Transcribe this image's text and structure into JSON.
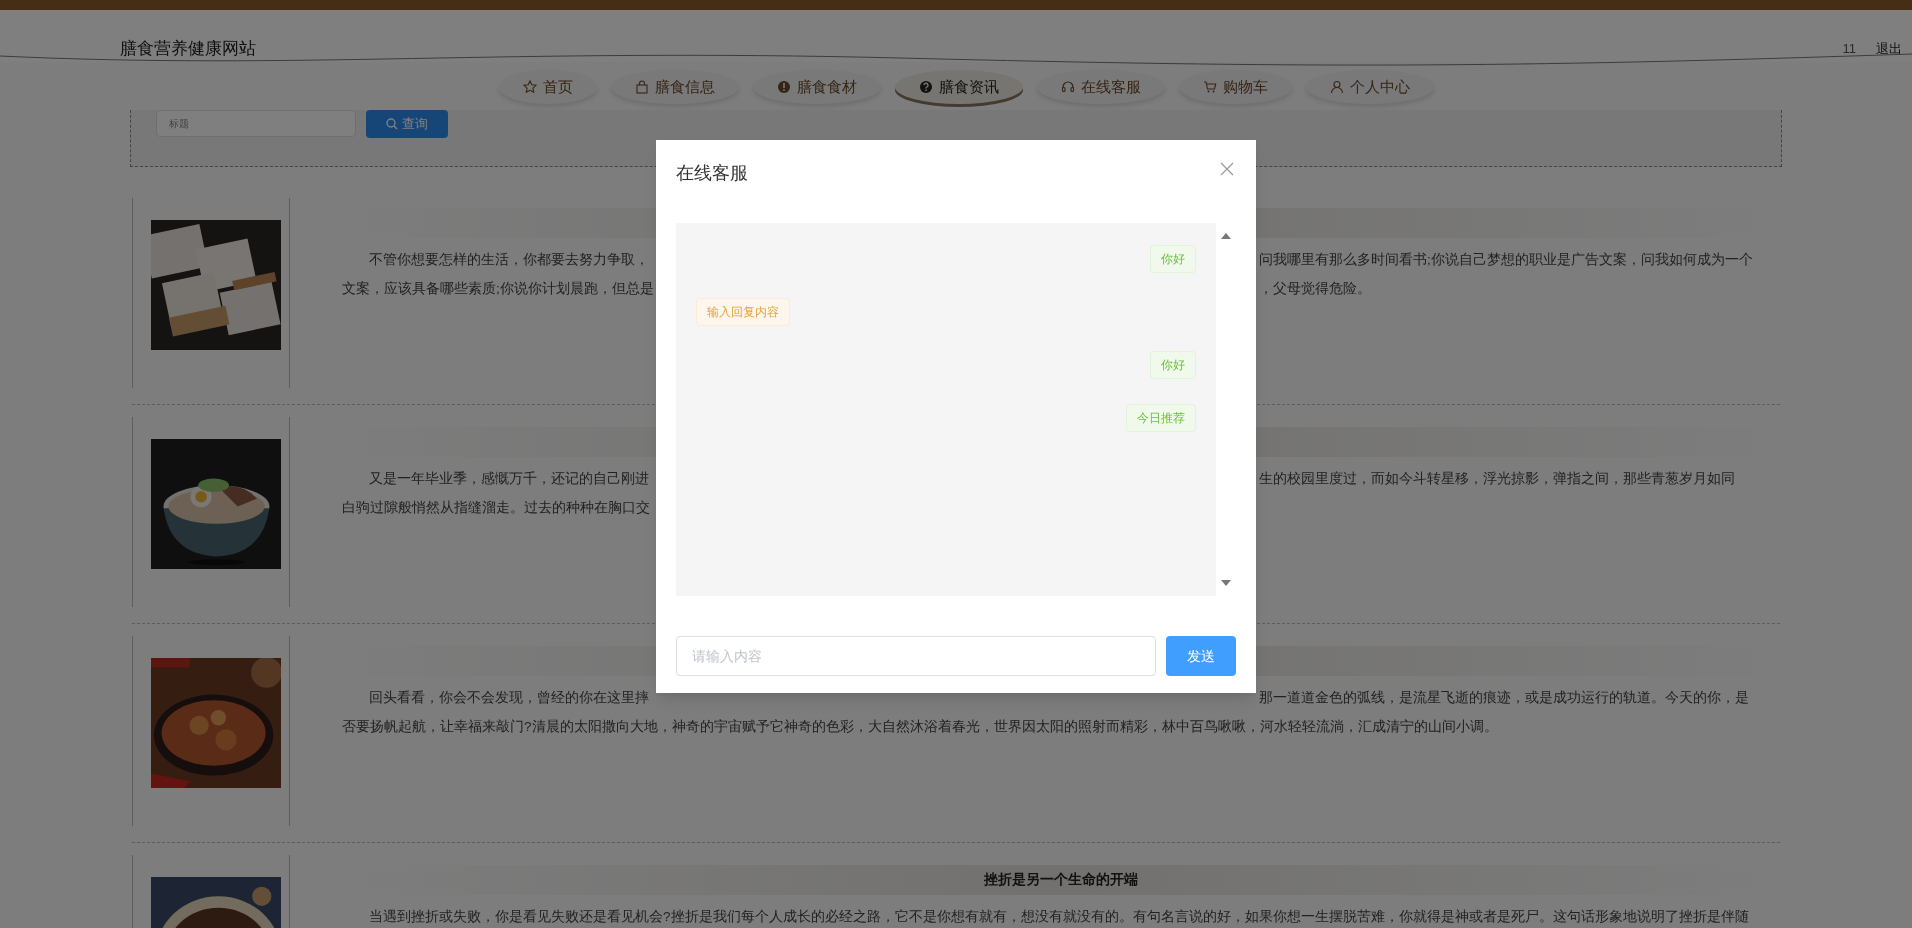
{
  "header": {
    "site_title": "膳食营养健康网站",
    "user": "11",
    "logout": "退出"
  },
  "nav": [
    {
      "label": "首页",
      "selected": false
    },
    {
      "label": "膳食信息",
      "selected": false
    },
    {
      "label": "膳食食材",
      "selected": false
    },
    {
      "label": "膳食资讯",
      "selected": true
    },
    {
      "label": "在线客服",
      "selected": false
    },
    {
      "label": "购物车",
      "selected": false
    },
    {
      "label": "个人中心",
      "selected": false
    }
  ],
  "search": {
    "placeholder": "标题",
    "button": "查询"
  },
  "articles": [
    {
      "image": {
        "kind": "picture"
      },
      "lines": [
        {
          "left": "不管你想要怎样的生活，你都要去努力争取，",
          "right": "问我哪里有那么多时间看书;你说自己梦想的职业是广告文案，问我如何成为一个"
        },
        {
          "left": "文案，应该具备哪些素质;你说你计划晨跑，但总是",
          "right": "，父母觉得危险。"
        }
      ]
    },
    {
      "image": {
        "kind": "picture"
      },
      "lines": [
        {
          "left": "又是一年毕业季，感慨万千，还记的自己刚进",
          "right": "生的校园里度过，而如今斗转星移，浮光掠影，弹指之间，那些青葱岁月如同"
        },
        {
          "left": "白驹过隙般悄然从指缝溜走。过去的种种在胸口交"
        }
      ]
    },
    {
      "image": {
        "kind": "picture"
      },
      "lines": [
        {
          "left": "回头看看，你会不会发现，曾经的你在这里摔",
          "right": "那一道道金色的弧线，是流星飞逝的痕迹，或是成功运行的轨道。今天的你，是"
        },
        {
          "full": "否要扬帆起航，让幸福来敲门?清晨的太阳撒向大地，神奇的宇宙赋予它神奇的色彩，大自然沐浴着春光，世界因太阳的照射而精彩，林中百鸟啾啾，河水轻轻流淌，汇成清宁的山间小调。"
        }
      ]
    },
    {
      "image": {
        "kind": "picture"
      },
      "title": "挫折是另一个生命的开端",
      "lines": [
        {
          "full": "当遇到挫折或失败，你是看见失败还是看见机会?挫折是我们每个人成长的必经之路，它不是你想有就有，想没有就没有的。有句名言说的好，如果你想一生摆脱苦难，你就得是神或者是死尸。这句话形象地说明了挫折是伴随"
        }
      ]
    }
  ],
  "dialog": {
    "title": "在线客服",
    "messages": [
      {
        "text": "你好",
        "kind": "sent"
      },
      {
        "text": "输入回复内容",
        "kind": "received"
      },
      {
        "text": "你好",
        "kind": "sent"
      },
      {
        "text": "今日推荐",
        "kind": "sent"
      }
    ],
    "input_placeholder": "请输入内容",
    "send_button": "发送"
  }
}
